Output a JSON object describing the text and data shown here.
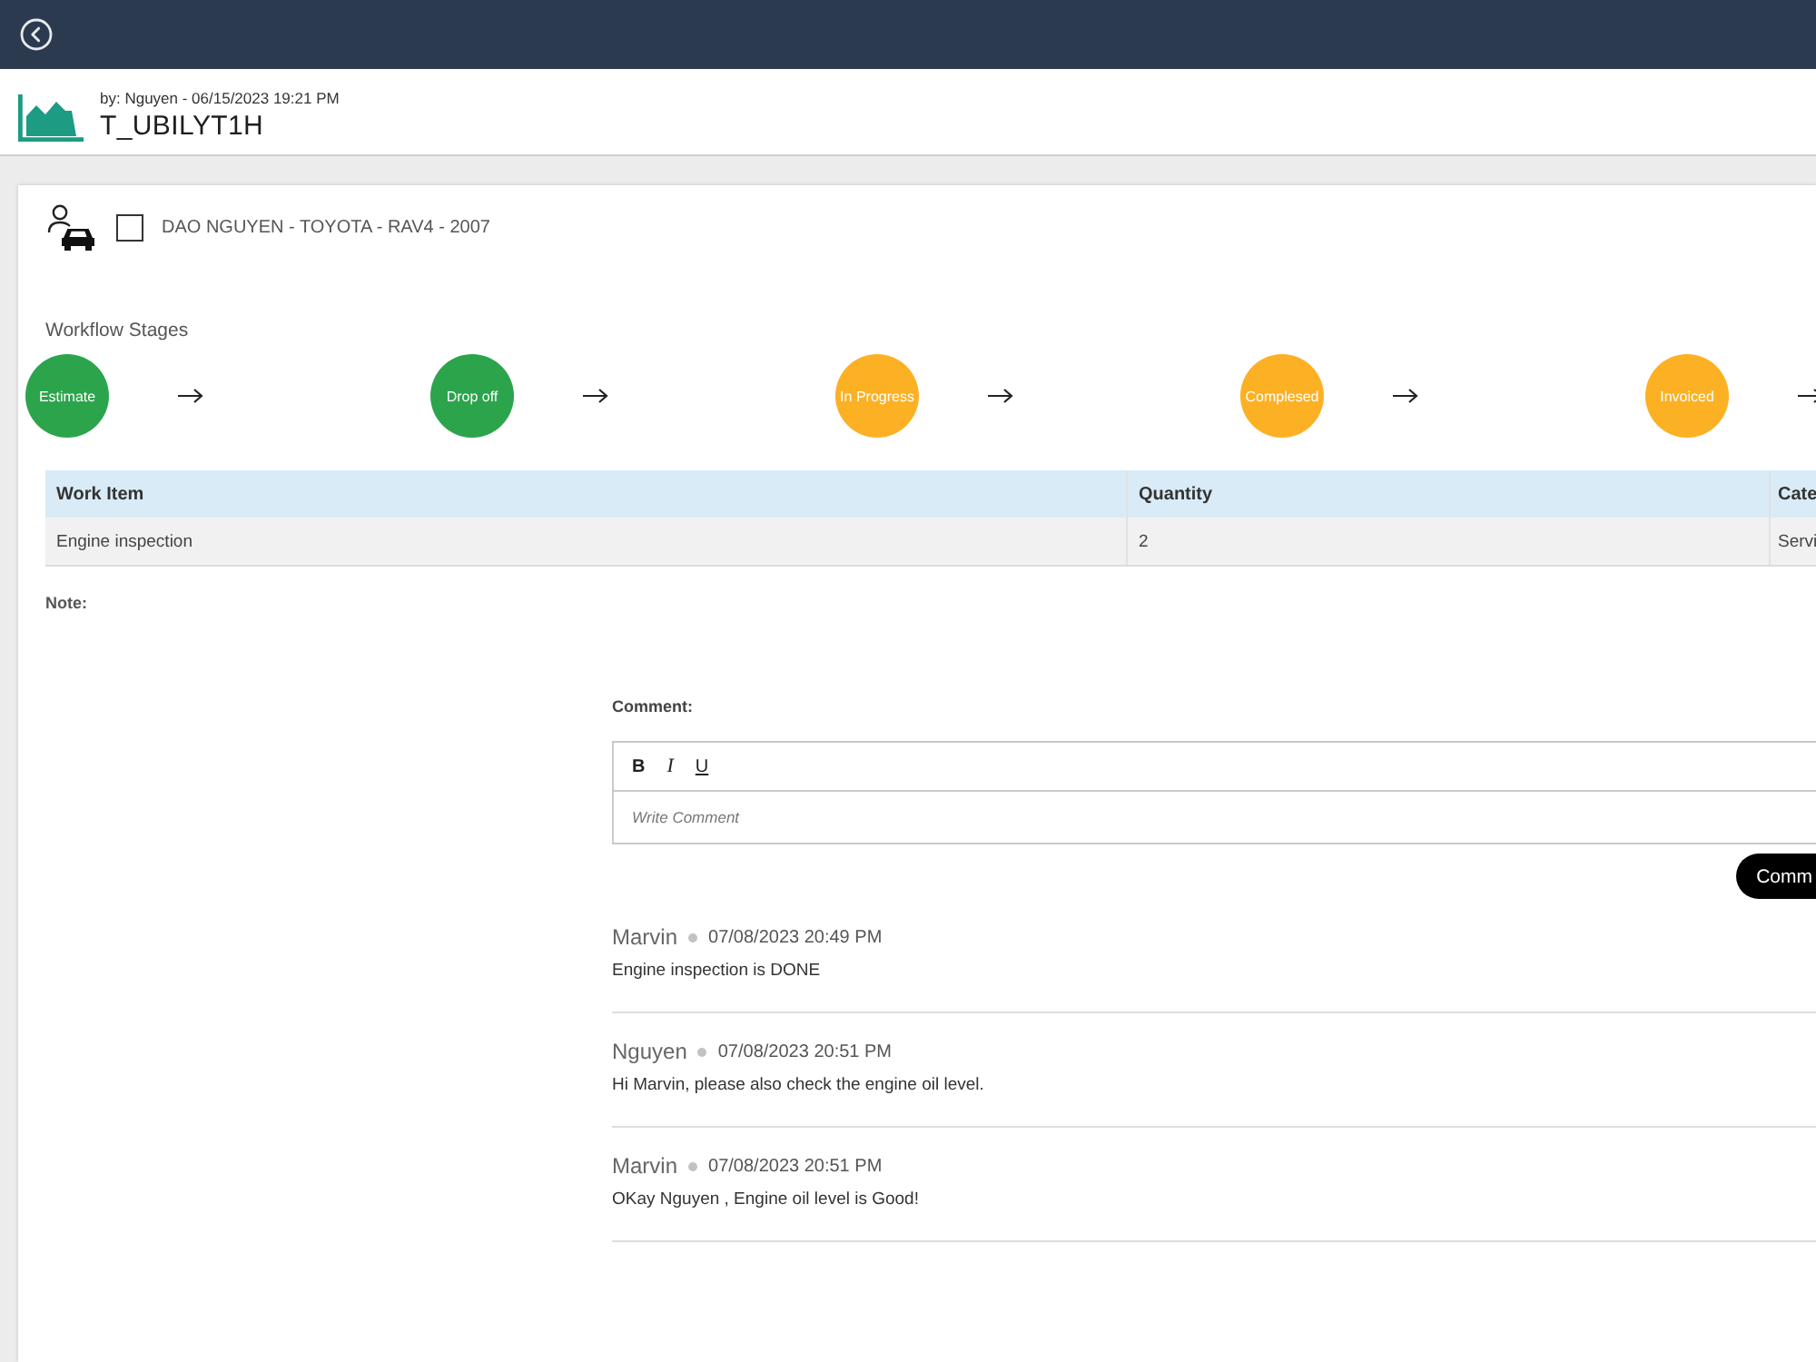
{
  "header": {
    "byline": "by: Nguyen - 06/15/2023 19:21 PM",
    "title": "T_UBILYT1H"
  },
  "customer": {
    "checked": false,
    "label": "DAO NGUYEN - TOYOTA - RAV4 - 2007"
  },
  "workflow": {
    "title": "Workflow Stages",
    "stages": [
      {
        "label": "Estimate",
        "color": "#2ca44c"
      },
      {
        "label": "Drop off",
        "color": "#2ca44c"
      },
      {
        "label": "In Progress",
        "color": "#fcb124"
      },
      {
        "label": "Complesed",
        "color": "#fcb124"
      },
      {
        "label": "Invoiced",
        "color": "#fcb124"
      }
    ]
  },
  "table": {
    "columns": [
      "Work Item",
      "Quantity",
      "Cate"
    ],
    "rows": [
      [
        "Engine inspection",
        "2",
        "Servi"
      ]
    ]
  },
  "note": {
    "label": "Note:"
  },
  "comment_form": {
    "label": "Comment:",
    "toolbar": [
      {
        "label": "B",
        "kind": "bold"
      },
      {
        "label": "I",
        "kind": "italic"
      },
      {
        "label": "U",
        "kind": "underline"
      }
    ],
    "placeholder": "Write Comment",
    "submit": "Comm"
  },
  "comments": [
    {
      "author": "Marvin",
      "time": "07/08/2023 20:49 PM",
      "text": "Engine inspection is DONE"
    },
    {
      "author": "Nguyen",
      "time": "07/08/2023 20:51 PM",
      "text": "Hi Marvin, please also check the engine oil level."
    },
    {
      "author": "Marvin",
      "time": "07/08/2023 20:51 PM",
      "text": "OKay Nguyen , Engine oil level is Good!"
    }
  ]
}
